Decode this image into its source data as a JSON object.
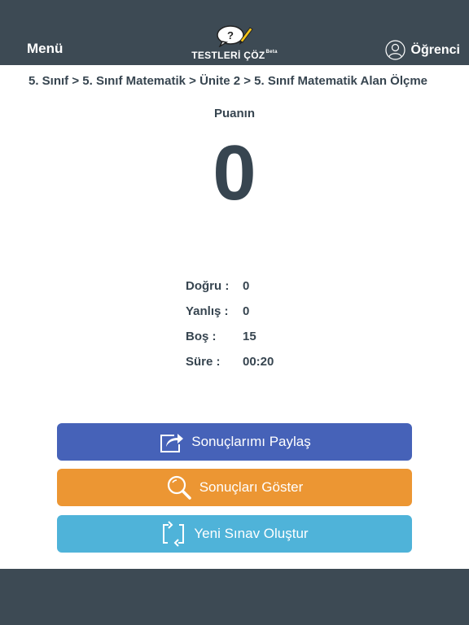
{
  "header": {
    "menu_label": "Menü",
    "logo_text": "TESTLERİ ÇÖZ",
    "logo_beta": "Beta",
    "user_label": "Öğrenci"
  },
  "breadcrumb": "5. Sınıf > 5. Sınıf Matematik > Ünite 2 > 5. Sınıf Matematik Alan Ölçme",
  "score": {
    "label": "Puanın",
    "value": "0"
  },
  "stats": [
    {
      "label": "Doğru :",
      "value": "0"
    },
    {
      "label": "Yanlış :",
      "value": "0"
    },
    {
      "label": "Boş :",
      "value": "15"
    },
    {
      "label": "Süre :",
      "value": "00:20"
    }
  ],
  "actions": {
    "share_label": "Sonuçlarımı Paylaş",
    "show_label": "Sonuçları Göster",
    "new_label": "Yeni Sınav Oluştur"
  },
  "colors": {
    "header_bg": "#3d4a54",
    "share": "#4662b8",
    "show": "#ec9633",
    "new": "#4fb3d9"
  }
}
